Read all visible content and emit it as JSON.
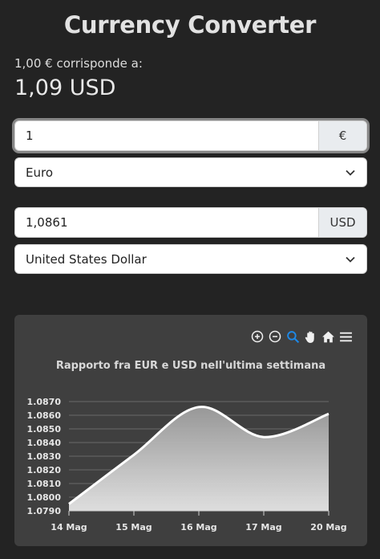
{
  "header": {
    "title": "Currency Converter"
  },
  "rate": {
    "label": "1,00 € corrisponde a:",
    "value": "1,09 USD"
  },
  "from": {
    "amount": "1",
    "symbol": "€",
    "currency": "Euro"
  },
  "to": {
    "amount": "1,0861",
    "symbol": "USD",
    "currency": "United States Dollar"
  },
  "toolbar": [
    "zoom-in-icon",
    "zoom-out-icon",
    "magnify-icon",
    "pan-hand-icon",
    "home-icon",
    "menu-icon"
  ],
  "colors": {
    "background": "#232323",
    "card": "#3f3f3f",
    "active_tool": "#1e88e5"
  },
  "chart_data": {
    "type": "area",
    "title": "Rapporto fra EUR e USD nell'ultima settimana",
    "categories": [
      "14 Mag",
      "15 Mag",
      "16 Mag",
      "17 Mag",
      "20 Mag"
    ],
    "series": [
      {
        "values": [
          1.0795,
          1.0831,
          1.0866,
          1.0844,
          1.0861
        ]
      }
    ],
    "yticks": [
      "1.0790",
      "1.0800",
      "1.0810",
      "1.0820",
      "1.0830",
      "1.0840",
      "1.0850",
      "1.0860",
      "1.0870"
    ],
    "ylim": [
      1.079,
      1.087
    ],
    "grid": true,
    "legend": "none"
  }
}
